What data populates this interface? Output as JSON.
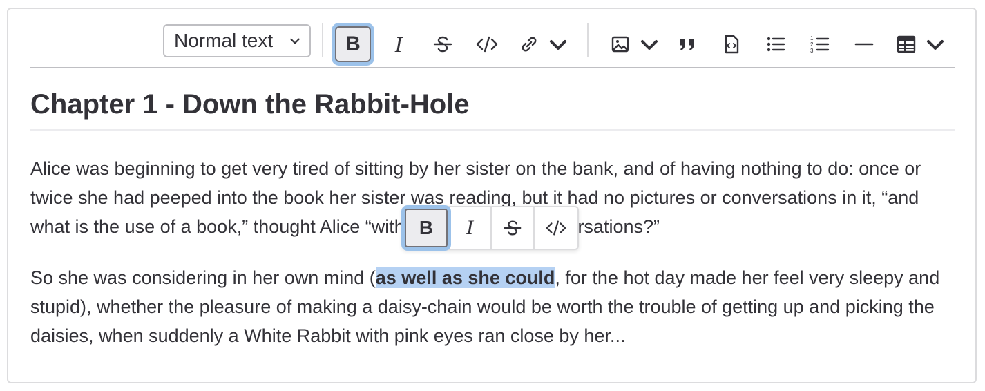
{
  "toolbar": {
    "text_style_value": "Normal text",
    "buttons": [
      {
        "name": "bold",
        "label": "B",
        "active": true
      },
      {
        "name": "italic",
        "label": "I"
      },
      {
        "name": "strikethrough",
        "icon": "strikethrough-icon"
      },
      {
        "name": "code",
        "icon": "code-icon"
      },
      {
        "name": "link",
        "icon": "link-icon"
      },
      {
        "name": "image",
        "icon": "image-icon"
      },
      {
        "name": "blockquote",
        "icon": "quote-icon"
      },
      {
        "name": "code-block",
        "icon": "code-block-icon"
      },
      {
        "name": "bullet-list",
        "icon": "bullet-list-icon"
      },
      {
        "name": "ordered-list",
        "icon": "ordered-list-icon"
      },
      {
        "name": "horizontal-rule",
        "icon": "horizontal-rule-icon"
      },
      {
        "name": "table",
        "icon": "table-icon"
      }
    ]
  },
  "document": {
    "heading": "Chapter 1 - Down the Rabbit-Hole",
    "paragraph1": "Alice was beginning to get very tired of sitting by her sister on the bank, and of having nothing to do: once or twice she had peeped into the book her sister was reading, but it had no pictures or conversations in it, “and what is the use of a book,” thought Alice “without pictures or conversations?”",
    "paragraph2_before": "So she was considering in her own mind (",
    "paragraph2_selected": "as well as she could",
    "paragraph2_after": ", for the hot day made her feel very sleepy and stupid), whether the pleasure of making a daisy-chain would be worth the trouble of getting up and picking the daisies, when suddenly a White Rabbit with pink eyes ran close by her..."
  },
  "bubble_menu": {
    "bold_label": "B",
    "italic_label": "I"
  },
  "colors": {
    "text": "#333238",
    "border": "#dcdcde",
    "focus_ring": "#9cc2ea",
    "selection": "#b5d1f3"
  }
}
